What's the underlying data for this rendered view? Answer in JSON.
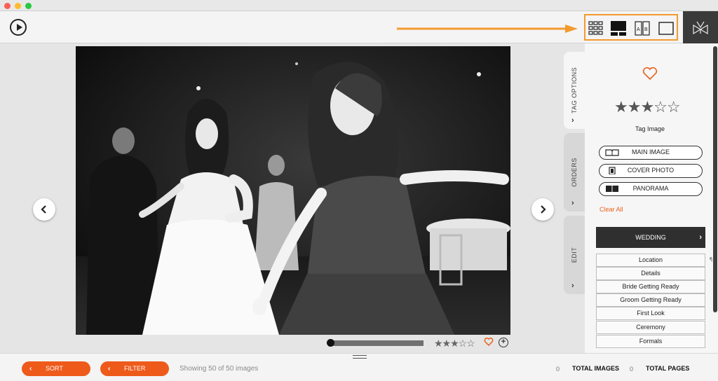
{
  "window": {
    "controls": [
      "close",
      "minimize",
      "zoom"
    ]
  },
  "toolbar": {
    "play_icon": "play-circle-icon",
    "view_modes": [
      {
        "name": "grid-view-icon"
      },
      {
        "name": "spread-view-icon"
      },
      {
        "name": "compare-ab-view-icon",
        "label_a": "A",
        "label_b": "B"
      },
      {
        "name": "single-view-icon"
      }
    ],
    "highlight_color": "#f39a2f",
    "logo_icon": "album-logo-icon"
  },
  "viewer": {
    "image_description_icon": "wedding-photo",
    "rating": 3,
    "rating_max": 5,
    "mini_stars": "★★★☆☆",
    "strip_position": 0,
    "plus_label": "+"
  },
  "side_tabs": [
    {
      "label": "TAG OPTIONS",
      "active": true
    },
    {
      "label": "ORDERS",
      "active": false
    },
    {
      "label": "EDIT",
      "active": false
    }
  ],
  "tag_panel": {
    "stars": "★★★☆☆",
    "rating": 3,
    "tag_label": "Tag Image",
    "buttons": [
      {
        "label": "MAIN IMAGE",
        "icon": "open-book-icon"
      },
      {
        "label": "COVER PHOTO",
        "icon": "cover-book-icon"
      },
      {
        "label": "PANORAMA",
        "icon": "panorama-book-icon"
      }
    ],
    "clear_all": "Clear All",
    "category": "WEDDING",
    "subcategories": [
      "Location",
      "Details",
      "Bride Getting Ready",
      "Groom Getting Ready",
      "First Look",
      "Ceremony",
      "Formals"
    ]
  },
  "bottom": {
    "sort_label": "SORT",
    "filter_label": "FILTER",
    "showing": "Showing 50 of 50 images",
    "total_images_count": "0",
    "total_images_label": "TOTAL IMAGES",
    "total_pages_count": "0",
    "total_pages_label": "TOTAL PAGES"
  },
  "colors": {
    "accent": "#ee5a1a",
    "dark": "#2f2f2f"
  }
}
